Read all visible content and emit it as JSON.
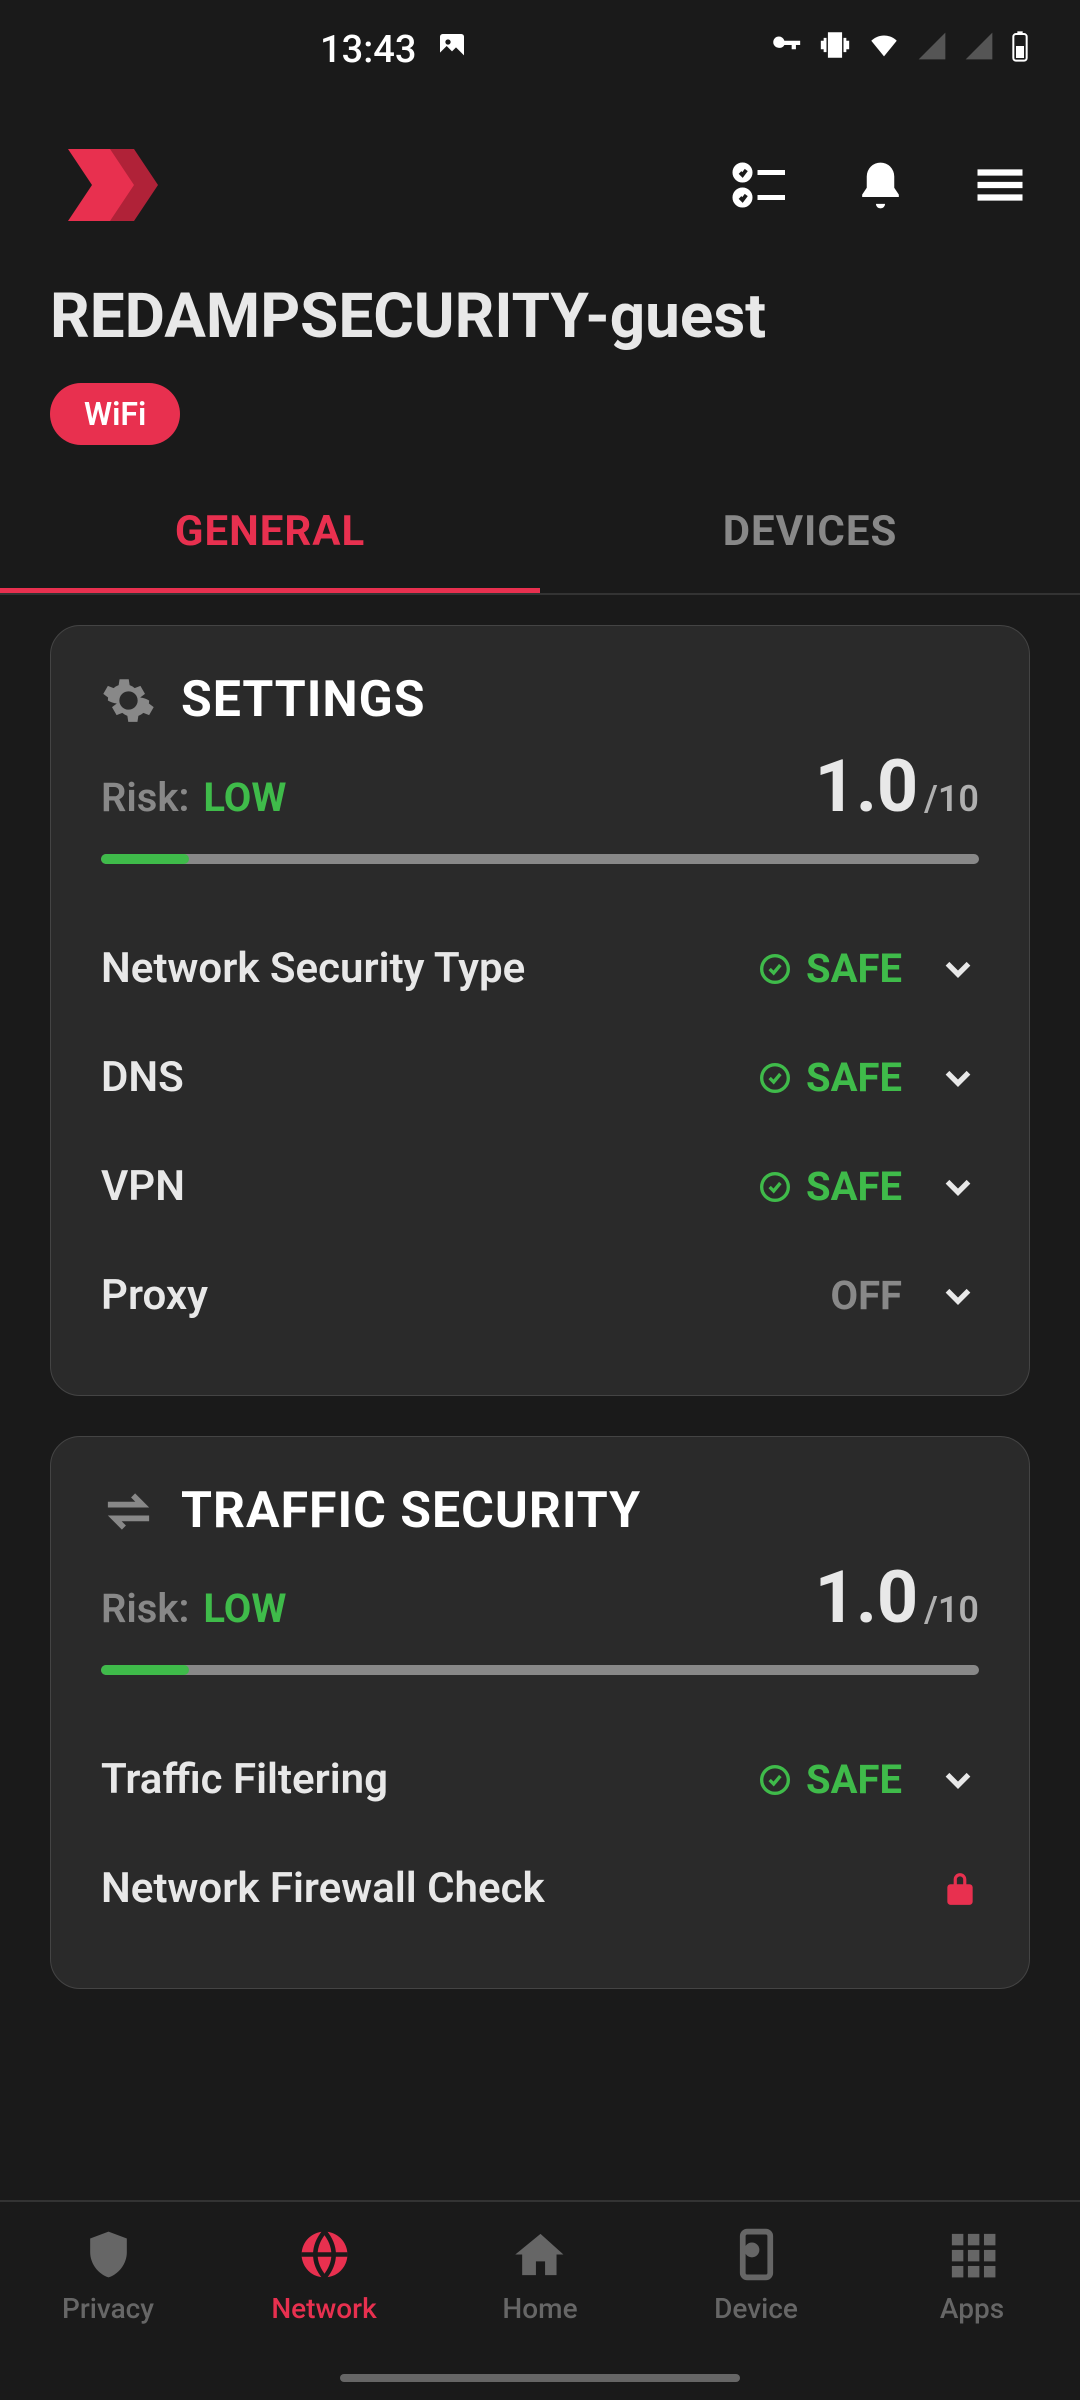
{
  "status_bar": {
    "time": "13:43"
  },
  "network": {
    "name": "REDAMPSECURITY-guest",
    "badge": "WiFi"
  },
  "tabs": {
    "general": "GENERAL",
    "devices": "DEVICES"
  },
  "settings_card": {
    "title": "SETTINGS",
    "risk_label": "Risk:",
    "risk_value": "LOW",
    "score": "1.0",
    "score_max": "/10",
    "progress_percent": 10,
    "items": [
      {
        "label": "Network Security Type",
        "status": "SAFE",
        "type": "safe"
      },
      {
        "label": "DNS",
        "status": "SAFE",
        "type": "safe"
      },
      {
        "label": "VPN",
        "status": "SAFE",
        "type": "safe"
      },
      {
        "label": "Proxy",
        "status": "OFF",
        "type": "off"
      }
    ]
  },
  "traffic_card": {
    "title": "TRAFFIC SECURITY",
    "risk_label": "Risk:",
    "risk_value": "LOW",
    "score": "1.0",
    "score_max": "/10",
    "progress_percent": 10,
    "items": [
      {
        "label": "Traffic Filtering",
        "status": "SAFE",
        "type": "safe"
      },
      {
        "label": "Network Firewall Check",
        "type": "locked"
      }
    ]
  },
  "bottom_nav": {
    "items": [
      {
        "label": "Privacy"
      },
      {
        "label": "Network"
      },
      {
        "label": "Home"
      },
      {
        "label": "Device"
      },
      {
        "label": "Apps"
      }
    ]
  }
}
